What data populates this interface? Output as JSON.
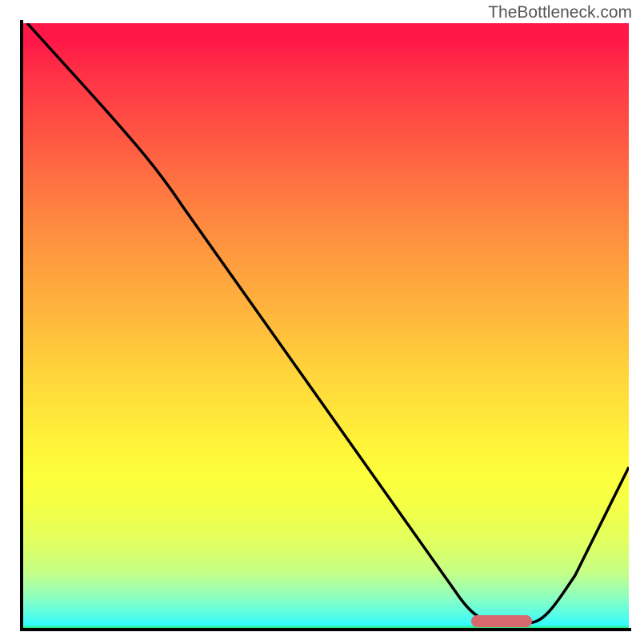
{
  "watermark": "TheBottleneck.com",
  "chart_data": {
    "type": "line",
    "x": [
      0,
      10,
      20,
      30,
      40,
      50,
      60,
      70,
      75,
      80,
      82,
      85,
      90,
      95,
      100
    ],
    "values": [
      100,
      89,
      77,
      61,
      45,
      30,
      15,
      4,
      0.5,
      0.5,
      0.5,
      2,
      9,
      17,
      28
    ],
    "ylim": [
      0,
      100
    ],
    "xlim": [
      0,
      100
    ],
    "title": "",
    "xlabel": "",
    "ylabel": "",
    "marker": {
      "x_start": 74,
      "x_end": 84,
      "y": 0.5
    },
    "gradient": {
      "top": "#ff1847",
      "mid_orange": "#ff8640",
      "mid_yellow": "#fff439",
      "bottom_green": "#25e863",
      "bottom_cyan": "#32fcff"
    }
  }
}
